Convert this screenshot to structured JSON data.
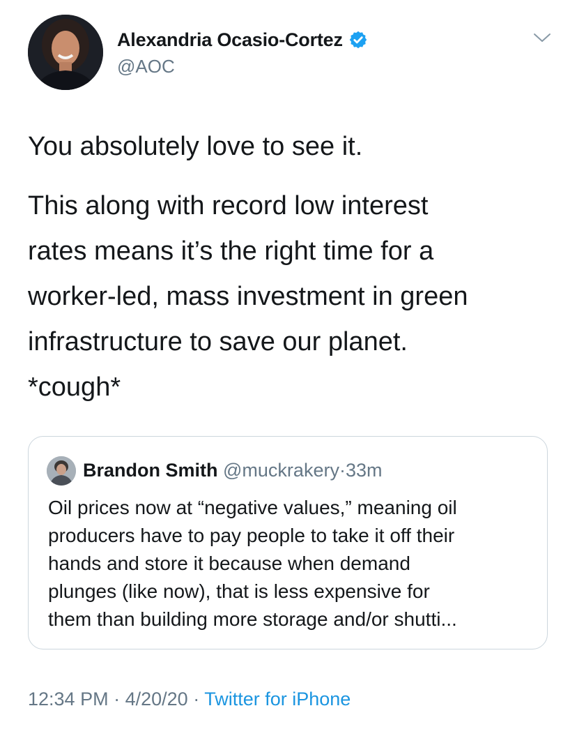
{
  "author": {
    "name": "Alexandria Ocasio-Cortez",
    "handle": "@AOC",
    "verified": true
  },
  "icons": {
    "verified": "verified-badge-icon",
    "menu": "chevron-down-icon"
  },
  "tweet": {
    "lines": [
      "You absolutely love to see it.",
      "This along with record low interest",
      "rates means it’s the right time for a",
      "worker-led, mass investment in green",
      "infrastructure to save our planet.",
      "*cough*"
    ]
  },
  "quoted_tweet": {
    "name": "Brandon Smith",
    "handle": "@muckrakery",
    "separator": "·",
    "time": "33m",
    "lines": [
      "Oil prices now at “negative values,” meaning oil",
      "producers have to pay people to take it off their",
      "hands and store it because when demand",
      "plunges (like now), that is less expensive for",
      "them than building more storage and/or shutti..."
    ]
  },
  "meta": {
    "time": "12:34 PM",
    "separator": "·",
    "date": "4/20/20",
    "source": "Twitter for iPhone"
  },
  "colors": {
    "text": "#14171a",
    "secondary": "#657786",
    "link": "#1b95e0",
    "verified": "#1da1f2",
    "border": "#ccd6dd"
  }
}
